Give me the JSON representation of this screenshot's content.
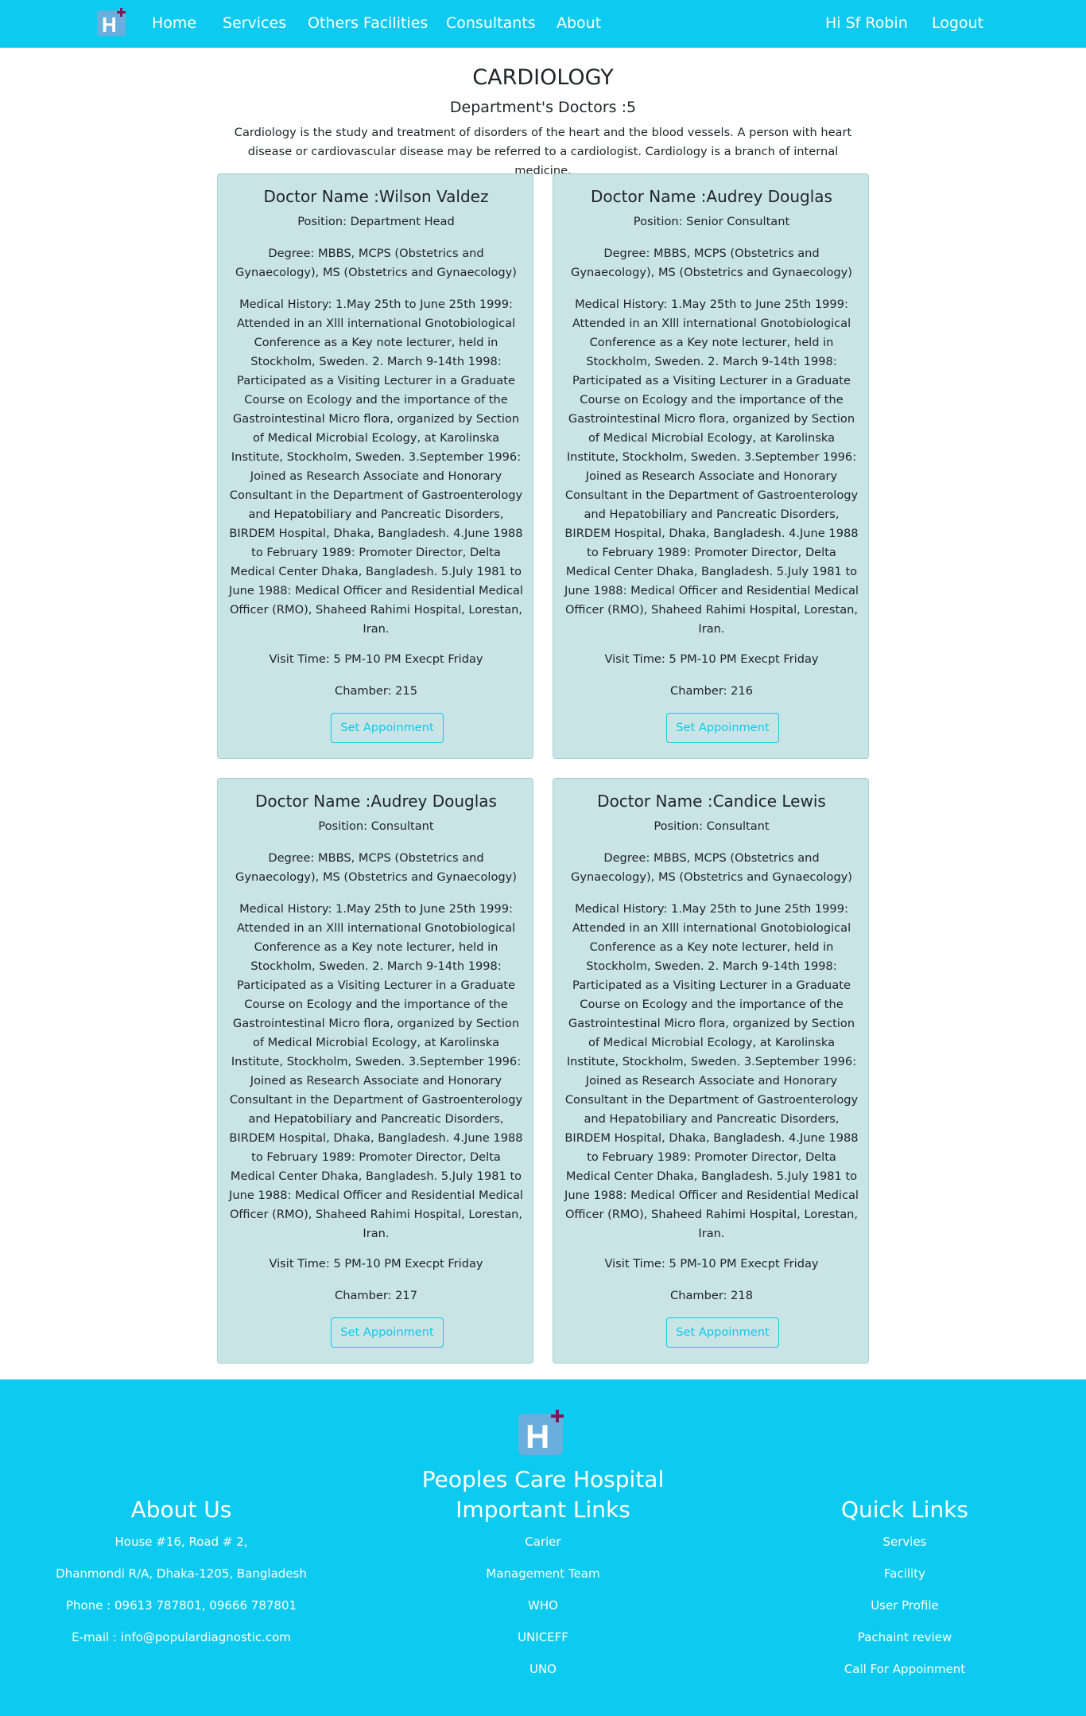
{
  "nav": {
    "logo_icon": "hospital-h-plus-icon",
    "home": "Home",
    "services": "Services",
    "facilities": "Others Facilities",
    "consultants": "Consultants",
    "about": "About",
    "greeting": "Hi Sf Robin",
    "logout": "Logout"
  },
  "department": {
    "title": "CARDIOLOGY",
    "doctor_count": "Department's Doctors :5",
    "description": "Cardiology is the study and treatment of disorders of the heart and the blood vessels. A person with heart disease or cardiovascular disease may be referred to a cardiologist. Cardiology is a branch of internal medicine."
  },
  "doctors": [
    {
      "name": "Doctor Name :Wilson Valdez",
      "position": "Position: Department Head",
      "degree": "Degree: MBBS, MCPS (Obstetrics and Gynaecology), MS (Obstetrics and Gynaecology)",
      "history": "Medical History: 1.May 25th to June 25th 1999: Attended in an Xlll international Gnotobiological Conference as a Key note lecturer, held in Stockholm, Sweden. 2. March 9-14th 1998: Participated as a Visiting Lecturer in a Graduate Course on Ecology and the importance of the Gastrointestinal Micro flora, organized by Section of Medical Microbial Ecology, at Karolinska Institute, Stockholm, Sweden. 3.September 1996: Joined as Research Associate and Honorary Consultant in the Department of Gastroenterology and Hepatobiliary and Pancreatic Disorders, BIRDEM Hospital, Dhaka, Bangladesh. 4.June 1988 to February 1989: Promoter Director, Delta Medical Center Dhaka, Bangladesh. 5.July 1981 to June 1988: Medical Officer and Residential Medical Officer (RMO), Shaheed Rahimi Hospital, Lorestan, Iran.",
      "visit_time": "Visit Time: 5 PM-10 PM Execpt Friday",
      "chamber": "Chamber: 215",
      "button": "Set Appoinment"
    },
    {
      "name": "Doctor Name :Audrey Douglas",
      "position": "Position: Senior Consultant",
      "degree": "Degree: MBBS, MCPS (Obstetrics and Gynaecology), MS (Obstetrics and Gynaecology)",
      "history": "Medical History: 1.May 25th to June 25th 1999: Attended in an Xlll international Gnotobiological Conference as a Key note lecturer, held in Stockholm, Sweden. 2. March 9-14th 1998: Participated as a Visiting Lecturer in a Graduate Course on Ecology and the importance of the Gastrointestinal Micro flora, organized by Section of Medical Microbial Ecology, at Karolinska Institute, Stockholm, Sweden. 3.September 1996: Joined as Research Associate and Honorary Consultant in the Department of Gastroenterology and Hepatobiliary and Pancreatic Disorders, BIRDEM Hospital, Dhaka, Bangladesh. 4.June 1988 to February 1989: Promoter Director, Delta Medical Center Dhaka, Bangladesh. 5.July 1981 to June 1988: Medical Officer and Residential Medical Officer (RMO), Shaheed Rahimi Hospital, Lorestan, Iran.",
      "visit_time": "Visit Time: 5 PM-10 PM Execpt Friday",
      "chamber": "Chamber: 216",
      "button": "Set Appoinment"
    },
    {
      "name": "Doctor Name :Audrey Douglas",
      "position": "Position: Consultant",
      "degree": "Degree: MBBS, MCPS (Obstetrics and Gynaecology), MS (Obstetrics and Gynaecology)",
      "history": "Medical History: 1.May 25th to June 25th 1999: Attended in an Xlll international Gnotobiological Conference as a Key note lecturer, held in Stockholm, Sweden. 2. March 9-14th 1998: Participated as a Visiting Lecturer in a Graduate Course on Ecology and the importance of the Gastrointestinal Micro flora, organized by Section of Medical Microbial Ecology, at Karolinska Institute, Stockholm, Sweden. 3.September 1996: Joined as Research Associate and Honorary Consultant in the Department of Gastroenterology and Hepatobiliary and Pancreatic Disorders, BIRDEM Hospital, Dhaka, Bangladesh. 4.June 1988 to February 1989: Promoter Director, Delta Medical Center Dhaka, Bangladesh. 5.July 1981 to June 1988: Medical Officer and Residential Medical Officer (RMO), Shaheed Rahimi Hospital, Lorestan, Iran.",
      "visit_time": "Visit Time: 5 PM-10 PM Execpt Friday",
      "chamber": "Chamber: 217",
      "button": "Set Appoinment"
    },
    {
      "name": "Doctor Name :Candice Lewis",
      "position": "Position: Consultant",
      "degree": "Degree: MBBS, MCPS (Obstetrics and Gynaecology), MS (Obstetrics and Gynaecology)",
      "history": "Medical History: 1.May 25th to June 25th 1999: Attended in an Xlll international Gnotobiological Conference as a Key note lecturer, held in Stockholm, Sweden. 2. March 9-14th 1998: Participated as a Visiting Lecturer in a Graduate Course on Ecology and the importance of the Gastrointestinal Micro flora, organized by Section of Medical Microbial Ecology, at Karolinska Institute, Stockholm, Sweden. 3.September 1996: Joined as Research Associate and Honorary Consultant in the Department of Gastroenterology and Hepatobiliary and Pancreatic Disorders, BIRDEM Hospital, Dhaka, Bangladesh. 4.June 1988 to February 1989: Promoter Director, Delta Medical Center Dhaka, Bangladesh. 5.July 1981 to June 1988: Medical Officer and Residential Medical Officer (RMO), Shaheed Rahimi Hospital, Lorestan, Iran.",
      "visit_time": "Visit Time: 5 PM-10 PM Execpt Friday",
      "chamber": "Chamber: 218",
      "button": "Set Appoinment"
    }
  ],
  "footer": {
    "logo_icon": "hospital-h-plus-icon",
    "hospital_name": "Peoples Care Hospital",
    "about": {
      "heading": "About Us",
      "lines": [
        "House #16, Road # 2,",
        "Dhanmondi R/A, Dhaka-1205, Bangladesh",
        "Phone : 09613 787801, 09666 787801",
        "E-mail : info@populardiagnostic.com"
      ]
    },
    "important": {
      "heading": "Important Links",
      "links": [
        "Carier",
        "Management Team",
        "WHO",
        "UNICEFF",
        "UNO"
      ]
    },
    "quick": {
      "heading": "Quick Links",
      "links": [
        "Servies",
        "Facility",
        "User Profile",
        "Pachaint review",
        "Call For Appoinment"
      ]
    }
  },
  "colors": {
    "primary": "#0dcaf0",
    "card_bg": "#c9e4e5",
    "logo_blue": "#6aaede",
    "logo_plus": "#7a1a5a"
  }
}
